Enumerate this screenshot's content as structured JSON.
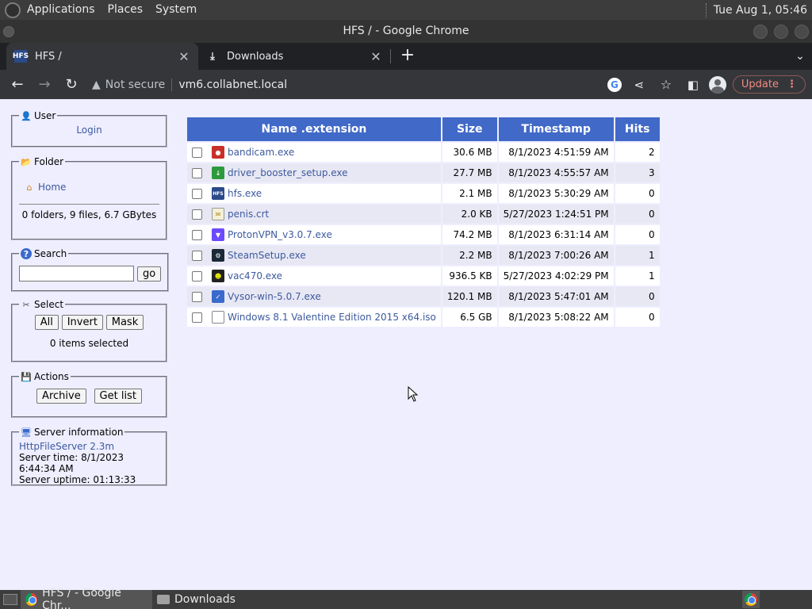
{
  "system_panel": {
    "menus": [
      "Applications",
      "Places",
      "System"
    ],
    "clock": "Tue Aug 1, 05:46"
  },
  "window": {
    "title": "HFS / - Google Chrome"
  },
  "tabs": [
    {
      "title": "HFS /",
      "icon": "hfs-favicon"
    },
    {
      "title": "Downloads",
      "icon": "download-icon"
    }
  ],
  "toolbar": {
    "security_label": "Not secure",
    "url": "vm6.collabnet.local",
    "update_label": "Update"
  },
  "sidebar": {
    "user": {
      "legend": "User",
      "login": "Login"
    },
    "folder": {
      "legend": "Folder",
      "home": "Home",
      "summary": "0 folders, 9 files, 6.7 GBytes"
    },
    "search": {
      "legend": "Search",
      "go": "go",
      "value": ""
    },
    "select": {
      "legend": "Select",
      "all": "All",
      "invert": "Invert",
      "mask": "Mask",
      "status": "0 items selected"
    },
    "actions": {
      "legend": "Actions",
      "archive": "Archive",
      "getlist": "Get list"
    },
    "server": {
      "legend": "Server information",
      "version": "HttpFileServer 2.3m",
      "time": "Server time: 8/1/2023 6:44:34 AM",
      "uptime": "Server uptime: 01:13:33"
    }
  },
  "files": {
    "headers": [
      "Name .extension",
      "Size",
      "Timestamp",
      "Hits"
    ],
    "rows": [
      {
        "name": "bandicam.exe",
        "size": "30.6 MB",
        "timestamp": "8/1/2023 4:51:59 AM",
        "hits": "2",
        "icon": "bandicam-icon"
      },
      {
        "name": "driver_booster_setup.exe",
        "size": "27.7 MB",
        "timestamp": "8/1/2023 4:55:57 AM",
        "hits": "3",
        "icon": "driver-booster-icon"
      },
      {
        "name": "hfs.exe",
        "size": "2.1 MB",
        "timestamp": "8/1/2023 5:30:29 AM",
        "hits": "0",
        "icon": "hfs-icon"
      },
      {
        "name": "penis.crt",
        "size": "2.0 KB",
        "timestamp": "5/27/2023 1:24:51 PM",
        "hits": "0",
        "icon": "certificate-icon"
      },
      {
        "name": "ProtonVPN_v3.0.7.exe",
        "size": "74.2 MB",
        "timestamp": "8/1/2023 6:31:14 AM",
        "hits": "0",
        "icon": "protonvpn-icon"
      },
      {
        "name": "SteamSetup.exe",
        "size": "2.2 MB",
        "timestamp": "8/1/2023 7:00:26 AM",
        "hits": "1",
        "icon": "steam-icon"
      },
      {
        "name": "vac470.exe",
        "size": "936.5 KB",
        "timestamp": "5/27/2023 4:02:29 PM",
        "hits": "1",
        "icon": "vac-icon"
      },
      {
        "name": "Vysor-win-5.0.7.exe",
        "size": "120.1 MB",
        "timestamp": "8/1/2023 5:47:01 AM",
        "hits": "0",
        "icon": "vysor-icon"
      },
      {
        "name": "Windows 8.1 Valentine Edition 2015 x64.iso",
        "size": "6.5 GB",
        "timestamp": "8/1/2023 5:08:22 AM",
        "hits": "0",
        "icon": "file-icon"
      }
    ]
  },
  "taskbar": {
    "items": [
      {
        "label": "HFS / - Google Chr...",
        "icon": "chrome-icon"
      },
      {
        "label": "Downloads",
        "icon": "folder-icon"
      }
    ]
  }
}
